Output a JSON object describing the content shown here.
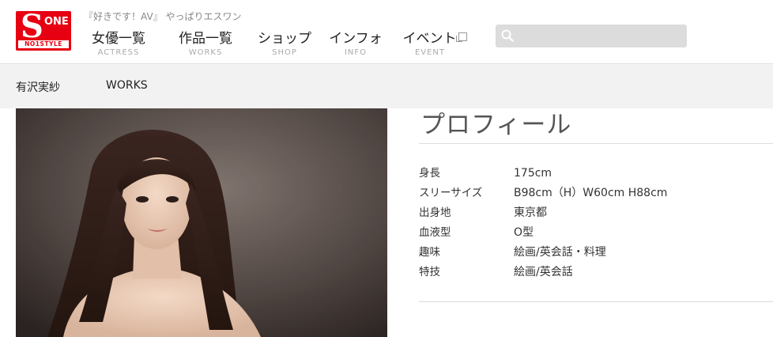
{
  "brand": {
    "logo_letter": "S",
    "logo_word": "ONE",
    "logo_sub": "NO1STYLE",
    "tagline": "『好きです！AV』 やっぱりエスワン"
  },
  "nav": {
    "items": [
      {
        "label": "女優一覧",
        "sublabel": "ACTRESS"
      },
      {
        "label": "作品一覧",
        "sublabel": "WORKS"
      },
      {
        "label": "ショップ",
        "sublabel": "SHOP"
      },
      {
        "label": "インフォ",
        "sublabel": "INFO"
      },
      {
        "label": "イベント",
        "sublabel": "EVENT"
      }
    ]
  },
  "search": {
    "placeholder": "",
    "value": ""
  },
  "subbar": {
    "actress_name": "有沢実紗",
    "works_link": "WORKS"
  },
  "profile": {
    "title": "プロフィール",
    "rows": [
      {
        "key": "身長",
        "value": "175cm"
      },
      {
        "key": "スリーサイズ",
        "value": "B98cm（H）W60cm H88cm"
      },
      {
        "key": "出身地",
        "value": "東京都"
      },
      {
        "key": "血液型",
        "value": "O型"
      },
      {
        "key": "趣味",
        "value": "絵画/英会話・料理"
      },
      {
        "key": "特技",
        "value": "絵画/英会話"
      }
    ]
  },
  "colors": {
    "brand_red": "#e60012",
    "subbar_bg": "#f2f2f2",
    "search_bg": "#dcdcdc"
  }
}
